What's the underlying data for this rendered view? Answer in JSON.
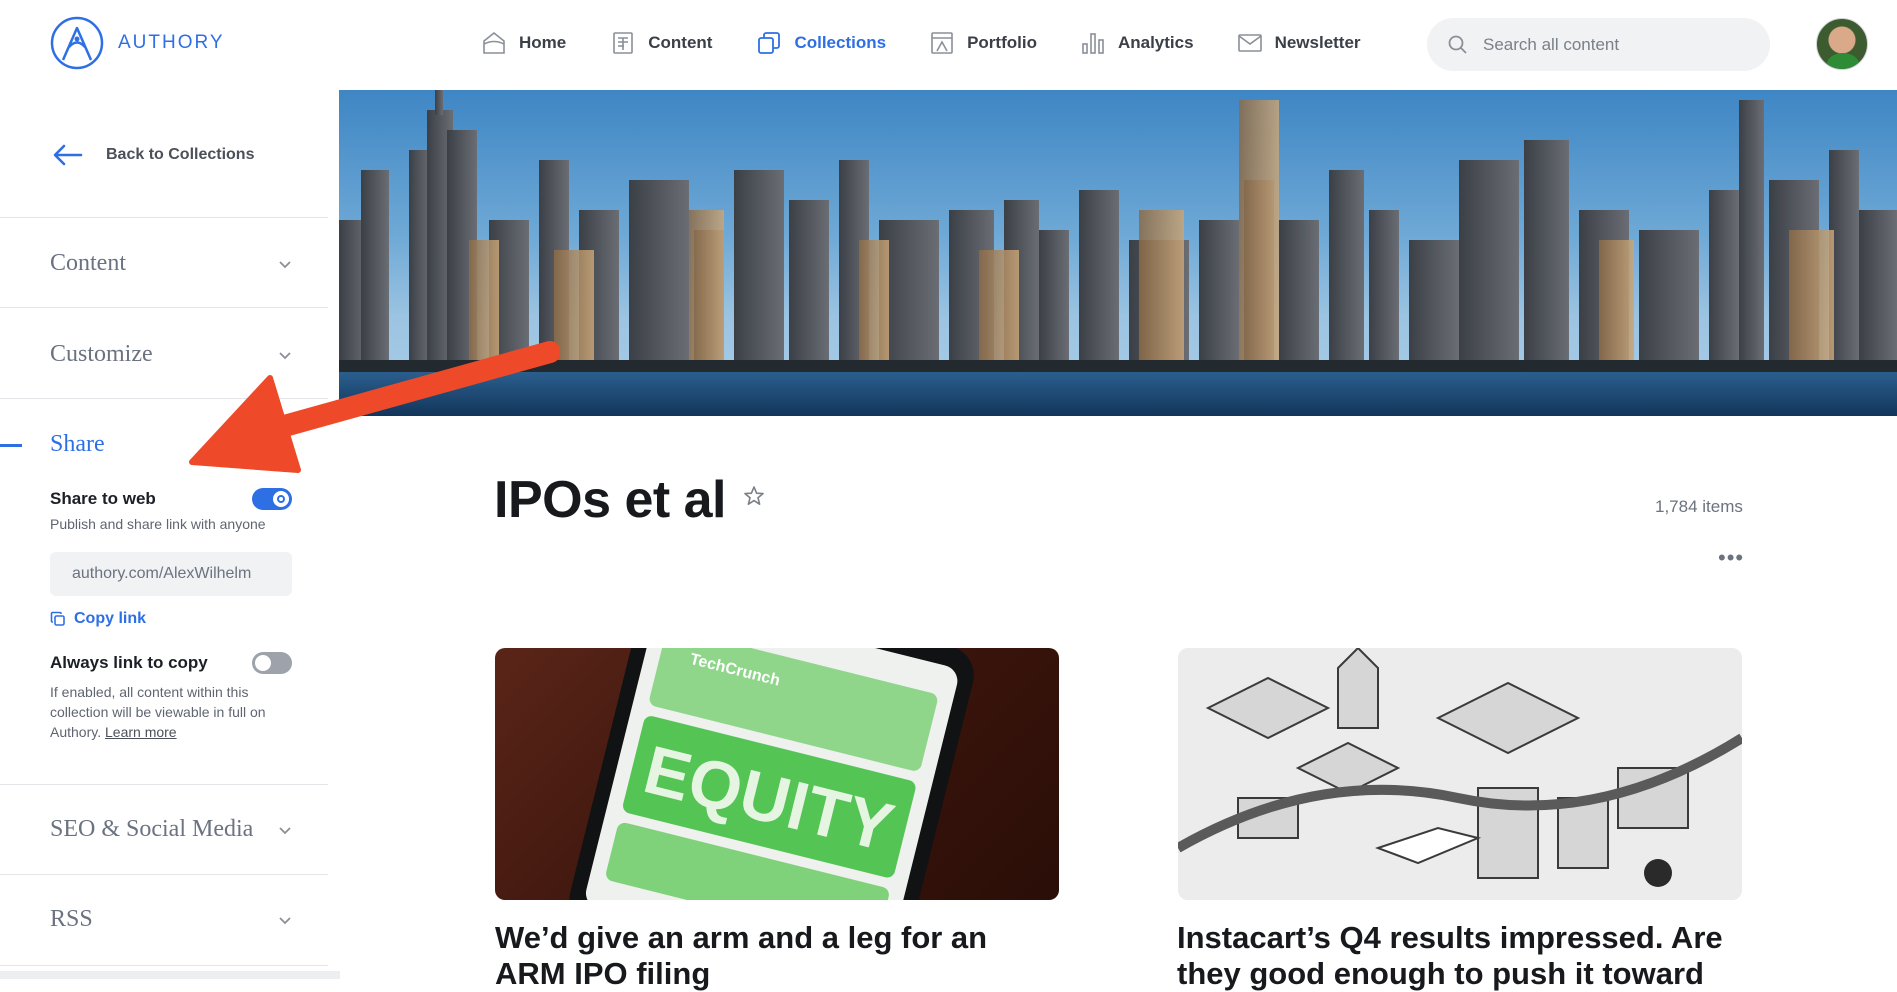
{
  "brand": {
    "name": "AUTHORY"
  },
  "nav": {
    "items": [
      {
        "label": "Home",
        "icon": "home-icon"
      },
      {
        "label": "Content",
        "icon": "document-icon"
      },
      {
        "label": "Collections",
        "icon": "collections-icon",
        "active": true
      },
      {
        "label": "Portfolio",
        "icon": "portfolio-icon"
      },
      {
        "label": "Analytics",
        "icon": "analytics-icon"
      },
      {
        "label": "Newsletter",
        "icon": "mail-icon"
      }
    ]
  },
  "search": {
    "placeholder": "Search all content"
  },
  "sidebar": {
    "back_label": "Back to Collections",
    "sections": [
      {
        "label": "Content",
        "expanded": false
      },
      {
        "label": "Customize",
        "expanded": false
      },
      {
        "label": "Share",
        "expanded": true
      },
      {
        "label": "SEO & Social Media",
        "expanded": false
      },
      {
        "label": "RSS",
        "expanded": false
      }
    ],
    "share": {
      "share_to_web_label": "Share to web",
      "share_to_web_on": true,
      "share_to_web_hint": "Publish and share link with anyone",
      "link_value": "authory.com/AlexWilhelm",
      "copy_link_label": "Copy link",
      "always_link_label": "Always link to copy",
      "always_link_on": false,
      "always_link_hint": "If enabled, all content within this collection will be viewable in full on Authory.",
      "learn_more_label": "Learn more"
    }
  },
  "collection": {
    "title": "IPOs et al",
    "item_count": "1,784 items",
    "more_label": "•••"
  },
  "cards": [
    {
      "title": "We’d give an arm and a leg for an ARM IPO filing",
      "image_text": "EQUITY",
      "image_brand": "TechCrunch"
    },
    {
      "title": "Instacart’s Q4 results impressed. Are they good enough to push it toward"
    }
  ],
  "colors": {
    "accent": "#2f6fe4",
    "annotation_arrow": "#ee4a2a"
  }
}
